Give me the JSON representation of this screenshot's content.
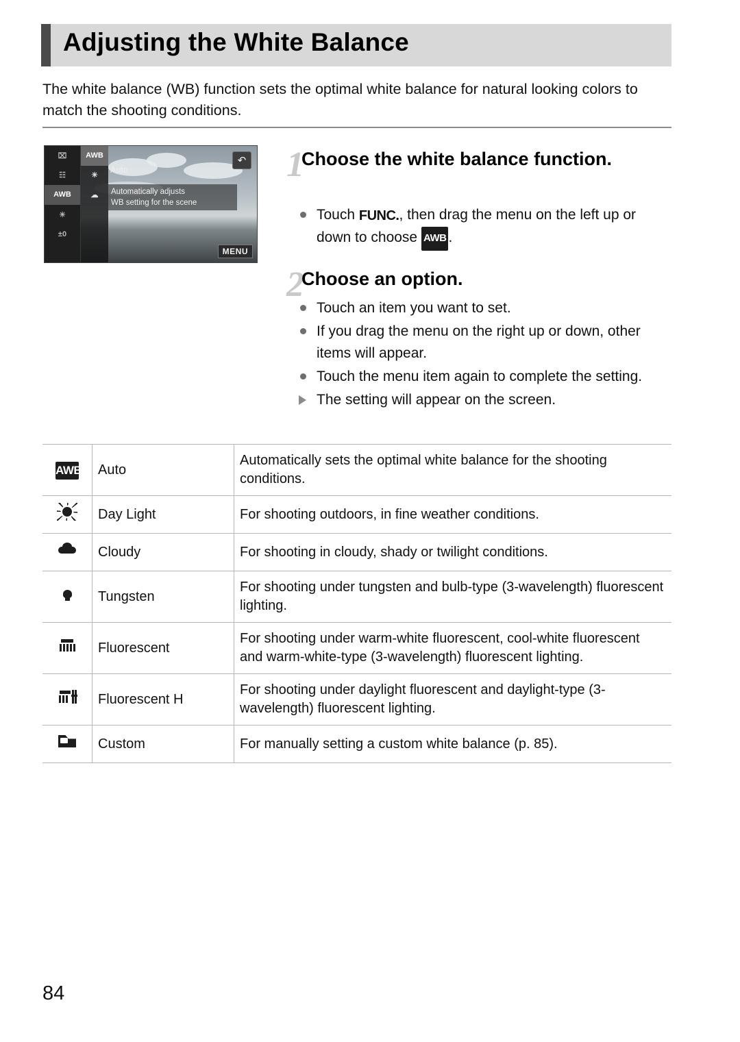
{
  "page": {
    "title": "Adjusting the White Balance",
    "intro": "The white balance (WB) function sets the optimal white balance for natural looking colors to match the shooting conditions.",
    "number": "84"
  },
  "illustration": {
    "left_column": [
      "⌧",
      "☷",
      "AWB",
      "☀",
      "±0"
    ],
    "menu_column": [
      "AWB",
      "☀",
      "☁"
    ],
    "selected_label": "Auto",
    "description_line1": "Automatically adjusts",
    "description_line2": "WB setting for the scene",
    "back_button": "↶",
    "menu_button": "MENU"
  },
  "steps": [
    {
      "number": "1",
      "title": "Choose the white balance function.",
      "bullets": [
        {
          "type": "dot",
          "pre": "Touch ",
          "glyph": "FUNC.",
          "mid": ", then drag the menu on the left up or down to choose ",
          "glyph2": "AWB",
          "post": "."
        }
      ]
    },
    {
      "number": "2",
      "title": "Choose an option.",
      "bullets": [
        {
          "type": "dot",
          "text": "Touch an item you want to set."
        },
        {
          "type": "dot",
          "text": "If you drag the menu on the right up or down, other items will appear."
        },
        {
          "type": "dot",
          "text": "Touch the menu item again to complete the setting."
        },
        {
          "type": "arrow",
          "text": "The setting will appear on the screen."
        }
      ]
    }
  ],
  "table": {
    "rows": [
      {
        "icon": "awb-icon",
        "icon_text": "AWB",
        "name": "Auto",
        "description": "Automatically sets the optimal white balance for the shooting conditions."
      },
      {
        "icon": "sun-icon",
        "icon_text": "",
        "name": "Day Light",
        "description": "For shooting outdoors, in fine weather conditions."
      },
      {
        "icon": "cloud-icon",
        "icon_text": "",
        "name": "Cloudy",
        "description": "For shooting in cloudy, shady or twilight conditions."
      },
      {
        "icon": "tungsten-bulb-icon",
        "icon_text": "",
        "name": "Tungsten",
        "description": "For shooting under tungsten and bulb-type (3-wavelength) fluorescent lighting."
      },
      {
        "icon": "fluorescent-icon",
        "icon_text": "",
        "name": "Fluorescent",
        "description": "For shooting under warm-white fluorescent, cool-white fluorescent and warm-white-type (3-wavelength) fluorescent lighting."
      },
      {
        "icon": "fluorescent-h-icon",
        "icon_text": "",
        "name": "Fluorescent H",
        "description": "For shooting under daylight fluorescent and daylight-type (3-wavelength) fluorescent lighting."
      },
      {
        "icon": "custom-wb-icon",
        "icon_text": "",
        "name": "Custom",
        "description": "For manually setting a custom white balance (p. 85)."
      }
    ]
  }
}
